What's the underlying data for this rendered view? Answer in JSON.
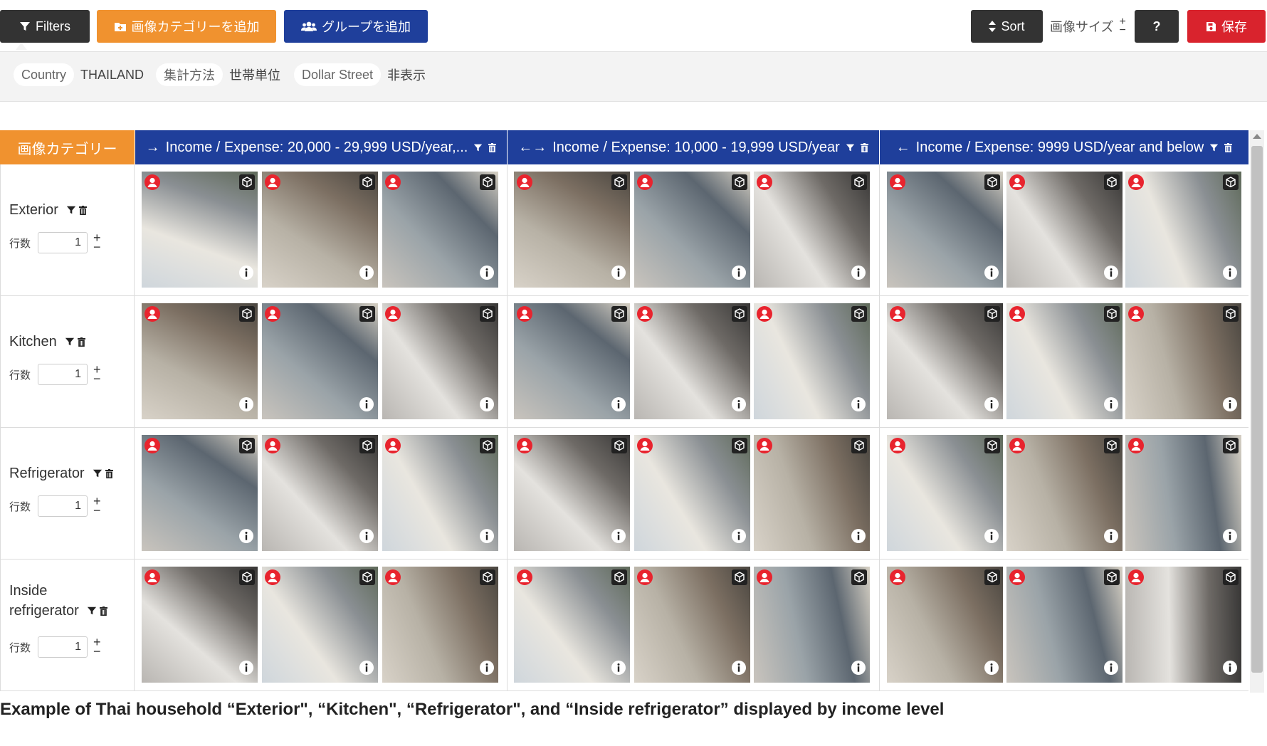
{
  "toolbar": {
    "filters_label": "Filters",
    "add_category_label": "画像カテゴリーを追加",
    "add_group_label": "グループを追加",
    "sort_label": "Sort",
    "image_size_label": "画像サイズ",
    "help_label": "?",
    "save_label": "保存"
  },
  "filters": [
    {
      "label": "Country",
      "value": "THAILAND"
    },
    {
      "label": "集計方法",
      "value": "世帯単位"
    },
    {
      "label": "Dollar Street",
      "value": "非表示"
    }
  ],
  "grid": {
    "category_header": "画像カテゴリー",
    "count_label": "行数",
    "columns": [
      {
        "label": "Income / Expense: 20,000 - 29,999 USD/year,...",
        "arrow": "→"
      },
      {
        "label": "Income / Expense: 10,000 - 19,999 USD/year",
        "arrow": "←→"
      },
      {
        "label": "Income / Expense: 9999 USD/year and below",
        "arrow": "←"
      }
    ],
    "rows": [
      {
        "name": "Exterior",
        "count": "1"
      },
      {
        "name": "Kitchen",
        "count": "1"
      },
      {
        "name": "Refrigerator",
        "count": "1"
      },
      {
        "name": "Inside refrigerator",
        "count": "1"
      }
    ]
  },
  "caption": "Example of Thai household “Exterior\", “Kitchen\", “Refrigerator\", and “Inside refrigerator” displayed by income level",
  "colors": {
    "dark": "#333333",
    "orange": "#f0922f",
    "blue": "#1f3f9b",
    "red": "#d9232d"
  }
}
